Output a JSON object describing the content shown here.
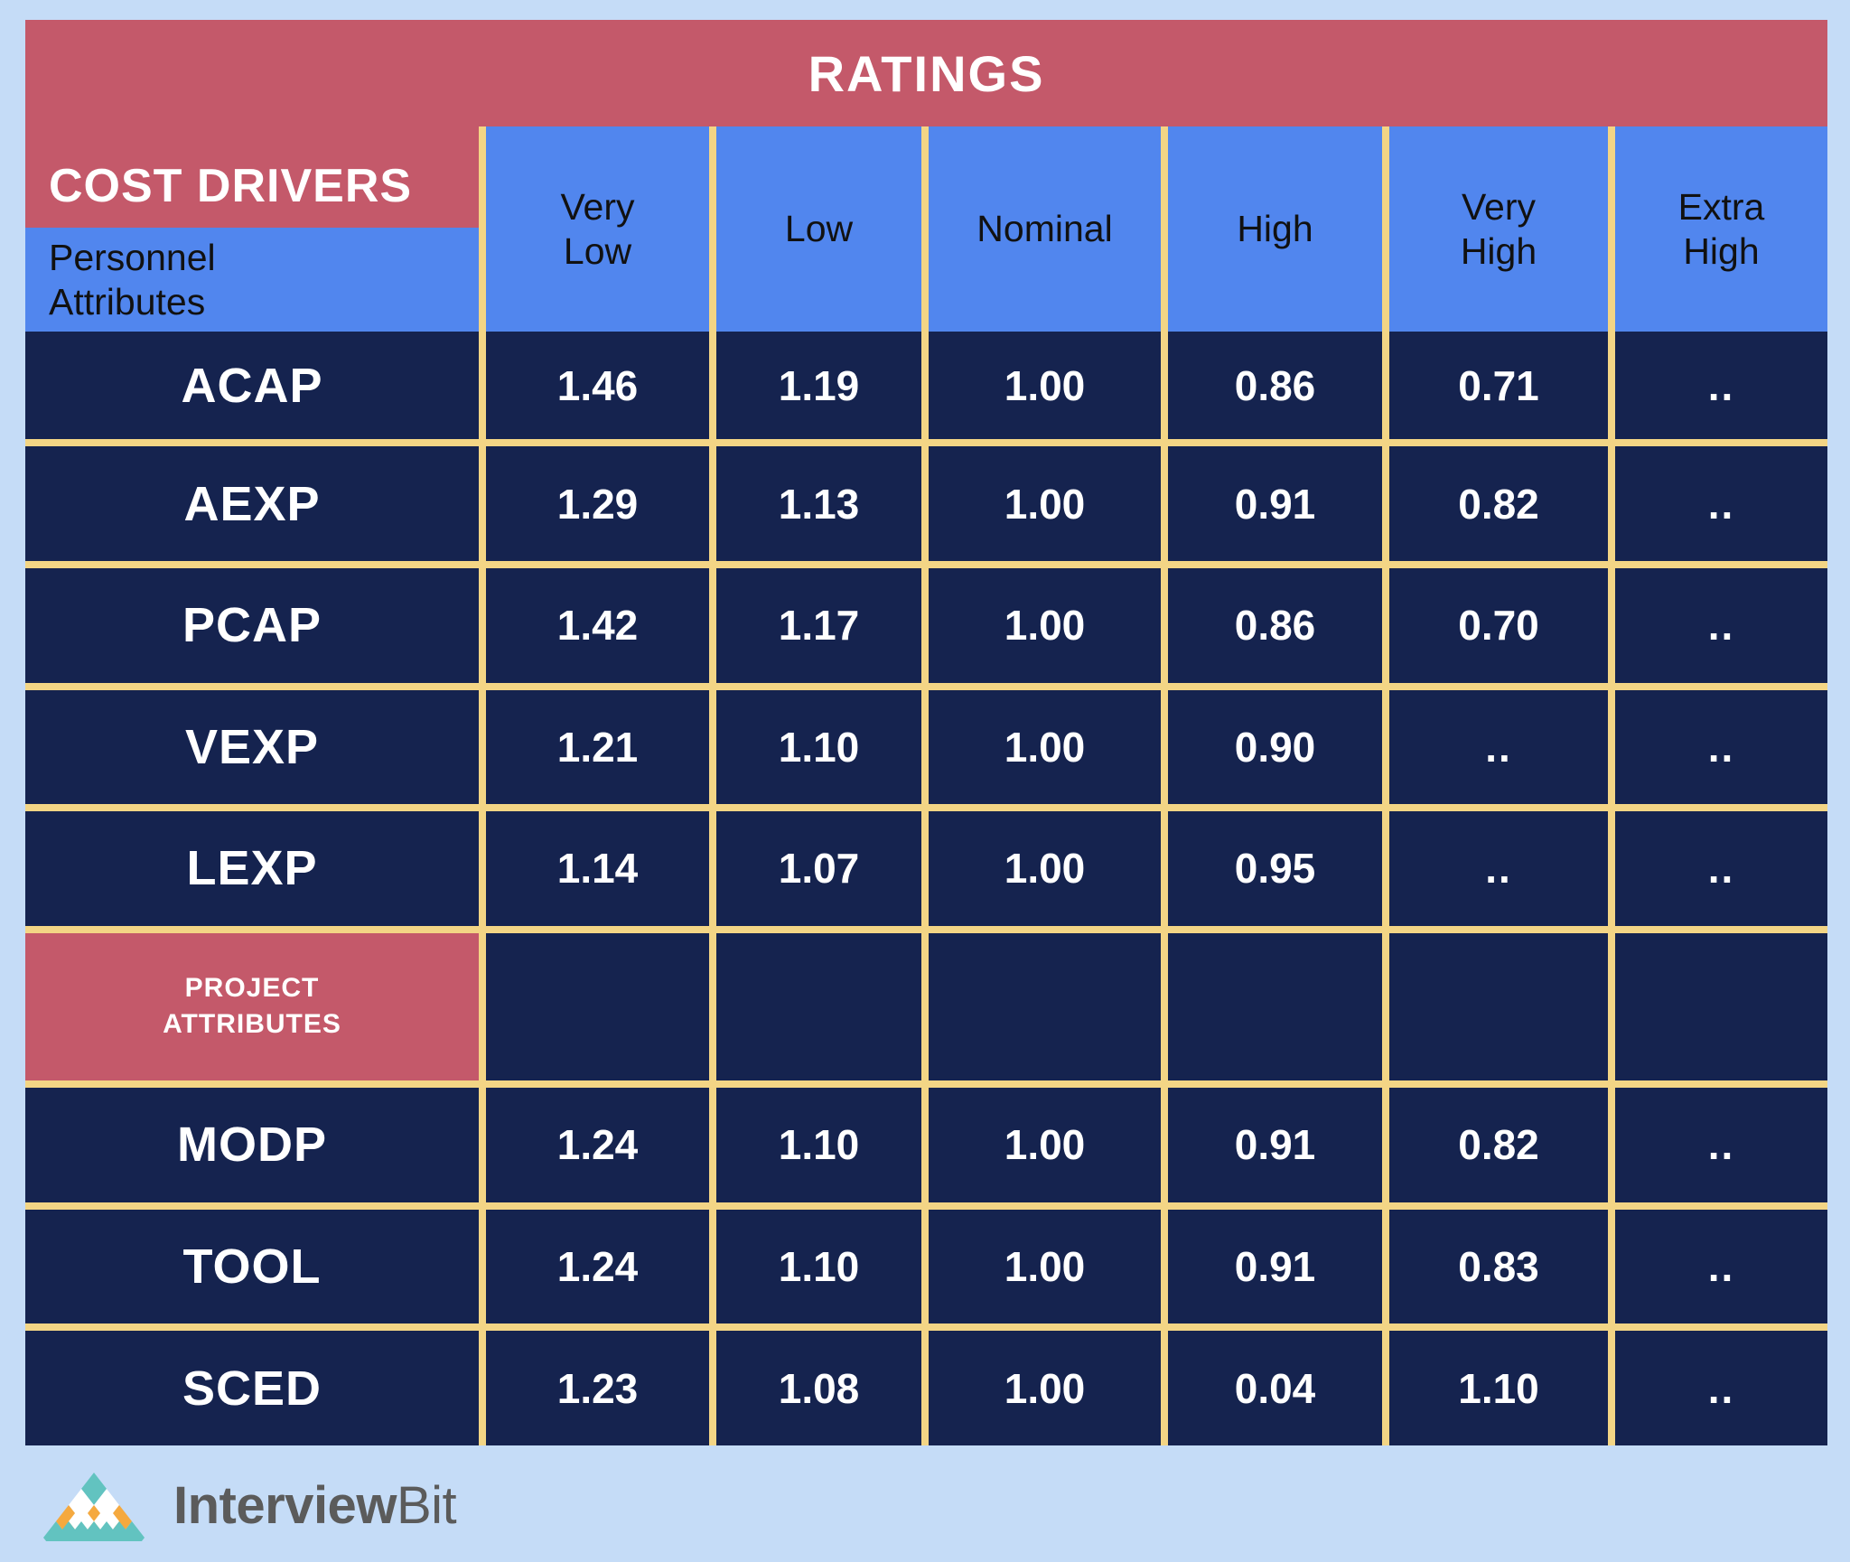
{
  "banner": {
    "ratings_title": "RATINGS",
    "cost_drivers_title": "COST DRIVERS"
  },
  "table": {
    "corner_label": "Personnel Attributes",
    "corner_label_line1": "Personnel",
    "corner_label_line2": "Attributes",
    "columns": [
      {
        "label": "Very Low",
        "line1": "Very",
        "line2": "Low"
      },
      {
        "label": "Low",
        "line1": "Low",
        "line2": ""
      },
      {
        "label": "Nominal",
        "line1": "Nominal",
        "line2": ""
      },
      {
        "label": "High",
        "line1": "High",
        "line2": ""
      },
      {
        "label": "Very High",
        "line1": "Very",
        "line2": "High"
      },
      {
        "label": "Extra High",
        "line1": "Extra",
        "line2": "High"
      }
    ],
    "section_divider": {
      "line1": "PROJECT",
      "line2": "ATTRIBUTES"
    },
    "rows": [
      {
        "driver": "ACAP",
        "values": [
          "1.46",
          "1.19",
          "1.00",
          "0.86",
          "0.71",
          ".."
        ]
      },
      {
        "driver": "AEXP",
        "values": [
          "1.29",
          "1.13",
          "1.00",
          "0.91",
          "0.82",
          ".."
        ]
      },
      {
        "driver": "PCAP",
        "values": [
          "1.42",
          "1.17",
          "1.00",
          "0.86",
          "0.70",
          ".."
        ]
      },
      {
        "driver": "VEXP",
        "values": [
          "1.21",
          "1.10",
          "1.00",
          "0.90",
          "..",
          ".."
        ]
      },
      {
        "driver": "LEXP",
        "values": [
          "1.14",
          "1.07",
          "1.00",
          "0.95",
          "..",
          ".."
        ]
      },
      {
        "driver": "MODP",
        "values": [
          "1.24",
          "1.10",
          "1.00",
          "0.91",
          "0.82",
          ".."
        ]
      },
      {
        "driver": "TOOL",
        "values": [
          "1.24",
          "1.10",
          "1.00",
          "0.91",
          "0.83",
          ".."
        ]
      },
      {
        "driver": "SCED",
        "values": [
          "1.23",
          "1.08",
          "1.00",
          "0.04",
          "1.10",
          ".."
        ]
      }
    ]
  },
  "footer": {
    "logo_text_bold": "Interview",
    "logo_text_light": "Bit"
  },
  "colors": {
    "page_background": "#c5dcf7",
    "banner_red": "#c4596a",
    "header_blue": "#5186ee",
    "cell_navy": "#15234f",
    "grid_gold": "#f3d585",
    "logo_teal": "#62c3c0",
    "logo_orange": "#f5a93f",
    "logo_white": "#ffffff",
    "logo_text_gray": "#5b5b5b"
  },
  "chart_data": {
    "type": "table",
    "title": "COCOMO Cost Drivers — Effort Multipliers by Rating",
    "categories": [
      "Very Low",
      "Low",
      "Nominal",
      "High",
      "Very High",
      "Extra High"
    ],
    "series": [
      {
        "name": "ACAP",
        "group": "Personnel Attributes",
        "values": [
          1.46,
          1.19,
          1.0,
          0.86,
          0.71,
          null
        ]
      },
      {
        "name": "AEXP",
        "group": "Personnel Attributes",
        "values": [
          1.29,
          1.13,
          1.0,
          0.91,
          0.82,
          null
        ]
      },
      {
        "name": "PCAP",
        "group": "Personnel Attributes",
        "values": [
          1.42,
          1.17,
          1.0,
          0.86,
          0.7,
          null
        ]
      },
      {
        "name": "VEXP",
        "group": "Personnel Attributes",
        "values": [
          1.21,
          1.1,
          1.0,
          0.9,
          null,
          null
        ]
      },
      {
        "name": "LEXP",
        "group": "Personnel Attributes",
        "values": [
          1.14,
          1.07,
          1.0,
          0.95,
          null,
          null
        ]
      },
      {
        "name": "MODP",
        "group": "Project Attributes",
        "values": [
          1.24,
          1.1,
          1.0,
          0.91,
          0.82,
          null
        ]
      },
      {
        "name": "TOOL",
        "group": "Project Attributes",
        "values": [
          1.24,
          1.1,
          1.0,
          0.91,
          0.83,
          null
        ]
      },
      {
        "name": "SCED",
        "group": "Project Attributes",
        "values": [
          1.23,
          1.08,
          1.0,
          0.04,
          1.1,
          null
        ]
      }
    ],
    "xlabel": "Ratings",
    "ylabel": "Cost Drivers",
    "missing_marker": ".."
  }
}
